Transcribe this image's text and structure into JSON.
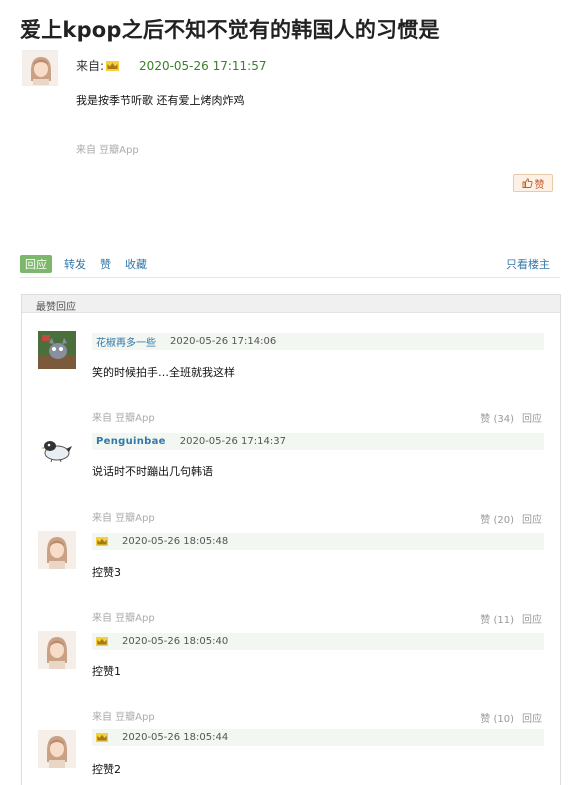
{
  "post": {
    "title": "爱上kpop之后不知不觉有的韩国人的习惯是",
    "from_label": "来自:",
    "time": "2020-05-26 17:11:57",
    "body": "我是按季节听歌 还有爱上烤肉炸鸡",
    "source": "来自 豆瓣App",
    "like_label": "赞"
  },
  "actions": {
    "reply": "回应",
    "repost": "转发",
    "like": "赞",
    "collect": "收藏",
    "only_op": "只看楼主"
  },
  "best_replies": {
    "header": "最赞回应",
    "items": [
      {
        "name": "花椒再多一些",
        "time": "2020-05-26 17:14:06",
        "body": "笑的时候拍手…全班就我这样",
        "source": "来自 豆瓣App",
        "votes": "赞 (34)",
        "reply": "回应",
        "avatar": "cartoon-cat"
      },
      {
        "name": "Penguinbae",
        "time": "2020-05-26 17:14:37",
        "body": "说话时不时蹦出几句韩语",
        "source": "来自 豆瓣App",
        "votes": "赞 (20)",
        "reply": "回应",
        "avatar": "penguin"
      },
      {
        "name": "",
        "time": "2020-05-26 18:05:48",
        "body": "控赞3",
        "source": "来自 豆瓣App",
        "votes": "赞 (11)",
        "reply": "回应",
        "avatar": "girl"
      },
      {
        "name": "",
        "time": "2020-05-26 18:05:40",
        "body": "控赞1",
        "source": "来自 豆瓣App",
        "votes": "赞 (10)",
        "reply": "回应",
        "avatar": "girl"
      },
      {
        "name": "",
        "time": "2020-05-26 18:05:44",
        "body": "控赞2",
        "source": "",
        "votes": "",
        "reply": "",
        "avatar": "girl"
      }
    ]
  },
  "colors": {
    "link": "#3377aa",
    "time_green": "#3a7f2a",
    "active_tab": "#7cb76b",
    "like_text": "#c25b26"
  }
}
